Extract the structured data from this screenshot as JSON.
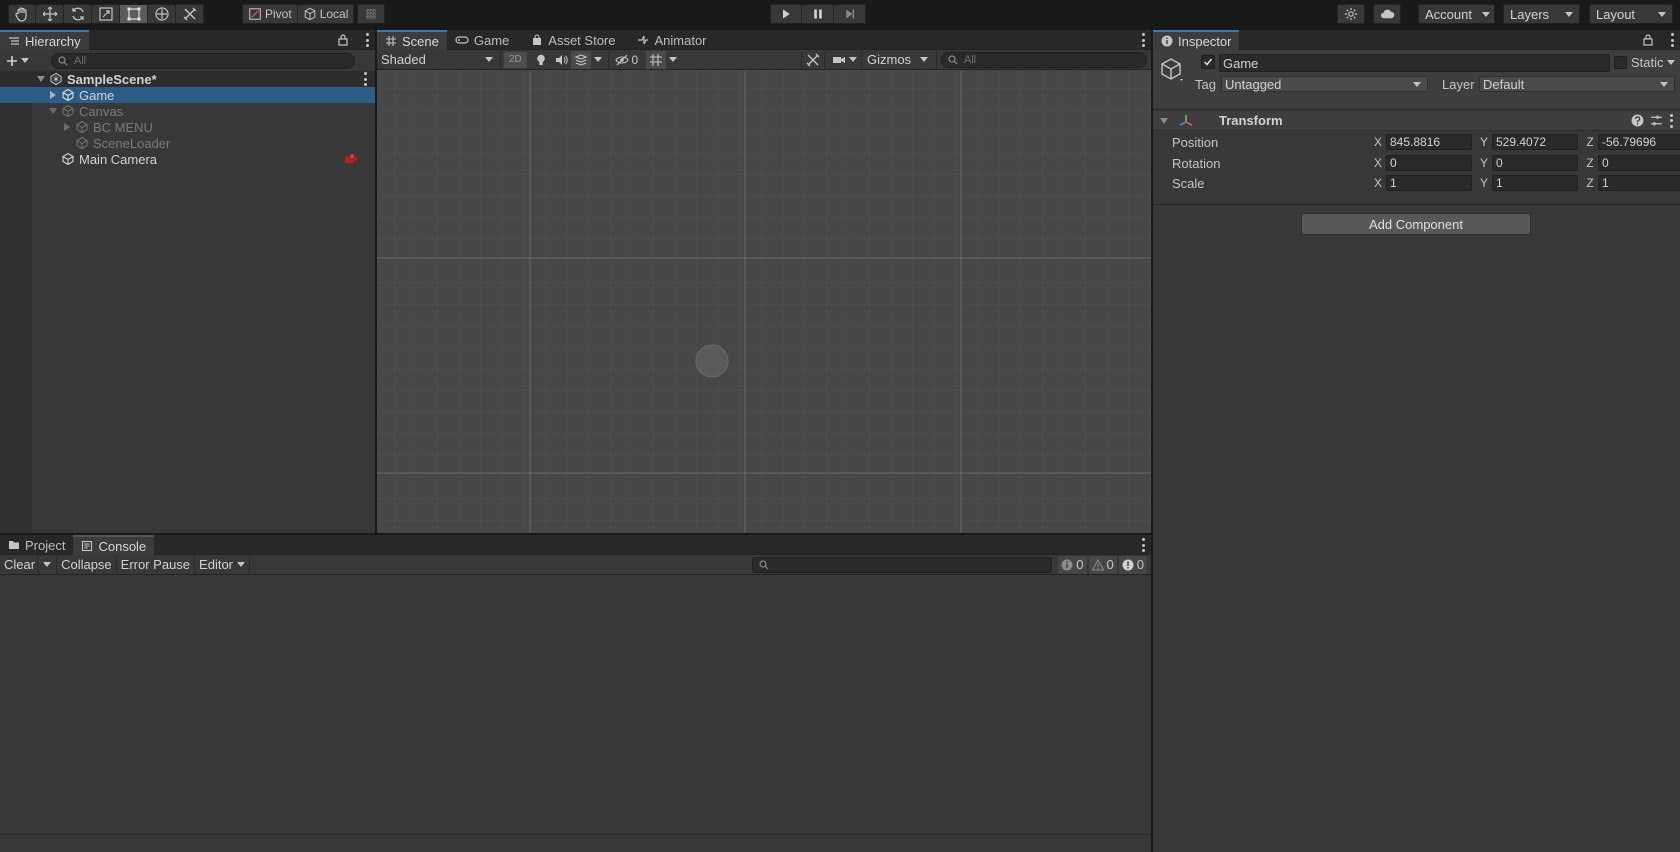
{
  "toolbar": {
    "tools": [
      {
        "name": "hand-tool",
        "icon": "hand-icon"
      },
      {
        "name": "move-tool",
        "icon": "move-icon"
      },
      {
        "name": "rotate-tool",
        "icon": "rotate-icon"
      },
      {
        "name": "scale-tool",
        "icon": "scale-icon"
      },
      {
        "name": "rect-tool",
        "icon": "rect-tool-icon",
        "active": true
      },
      {
        "name": "transform-tool",
        "icon": "transform-icon"
      },
      {
        "name": "custom-tool",
        "icon": "tools-icon"
      }
    ],
    "pivot_label": "Pivot",
    "local_label": "Local",
    "account_label": "Account",
    "layers_label": "Layers",
    "layout_label": "Layout"
  },
  "hierarchy": {
    "tab": "Hierarchy",
    "search_placeholder": "All",
    "items": [
      {
        "label": "SampleScene*",
        "kind": "scene"
      },
      {
        "label": "Game",
        "selected": true
      },
      {
        "label": "Canvas",
        "disabled": true
      },
      {
        "label": "BC MENU",
        "disabled": true
      },
      {
        "label": "SceneLoader",
        "disabled": true
      },
      {
        "label": "Main Camera"
      }
    ]
  },
  "scene": {
    "tabs": [
      "Scene",
      "Game",
      "Asset Store",
      "Animator"
    ],
    "shading_mode": "Shaded",
    "mode_2d": "2D",
    "hidden_count": "0",
    "gizmos_label": "Gizmos",
    "search_placeholder": "All"
  },
  "console": {
    "tabs": [
      "Project",
      "Console"
    ],
    "clear_label": "Clear",
    "collapse_label": "Collapse",
    "error_pause_label": "Error Pause",
    "editor_label": "Editor",
    "info_count": "0",
    "warning_count": "0",
    "error_count": "0"
  },
  "inspector": {
    "tab": "Inspector",
    "object_name": "Game",
    "static_label": "Static",
    "tag_label": "Tag",
    "tag_value": "Untagged",
    "layer_label": "Layer",
    "layer_value": "Default",
    "component_title": "Transform",
    "rows": [
      {
        "label": "Position",
        "x": "845.8816",
        "y": "529.4072",
        "z": "-56.79696"
      },
      {
        "label": "Rotation",
        "x": "0",
        "y": "0",
        "z": "0"
      },
      {
        "label": "Scale",
        "x": "1",
        "y": "1",
        "z": "1"
      }
    ],
    "axis_x": "X",
    "axis_y": "Y",
    "axis_z": "Z",
    "add_component_label": "Add Component"
  },
  "colors": {
    "accent": "#3a79bb",
    "selection": "#2c5d87",
    "panel_bg": "#383838",
    "scene_bg": "#474747"
  }
}
